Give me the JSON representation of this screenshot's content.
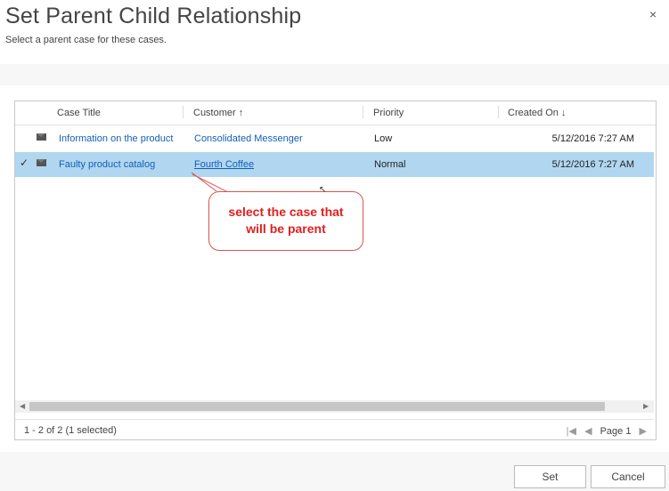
{
  "dialog": {
    "title": "Set Parent Child Relationship",
    "subtitle": "Select a parent case for these cases.",
    "close_glyph": "×"
  },
  "grid": {
    "columns": [
      "Case Title",
      "Customer ↑",
      "Priority",
      "Created On ↓"
    ],
    "rows": [
      {
        "title": "Information on the product",
        "customer": "Consolidated Messenger",
        "priority": "Low",
        "created": "5/12/2016 7:27 AM",
        "selected": false,
        "icon": "email-icon"
      },
      {
        "title": "Faulty product catalog",
        "customer": "Fourth Coffee",
        "priority": "Normal",
        "created": "5/12/2016 7:27 AM",
        "selected": true,
        "icon": "email-icon"
      }
    ],
    "status": "1 - 2 of 2 (1 selected)",
    "page_label": "Page 1"
  },
  "annotation": {
    "line1": "select the case that",
    "line2": "will be parent"
  },
  "buttons": {
    "set": "Set",
    "cancel": "Cancel"
  },
  "colors": {
    "selected_row": "#b1d6f0",
    "link": "#1160b7",
    "callout": "#e02020"
  }
}
